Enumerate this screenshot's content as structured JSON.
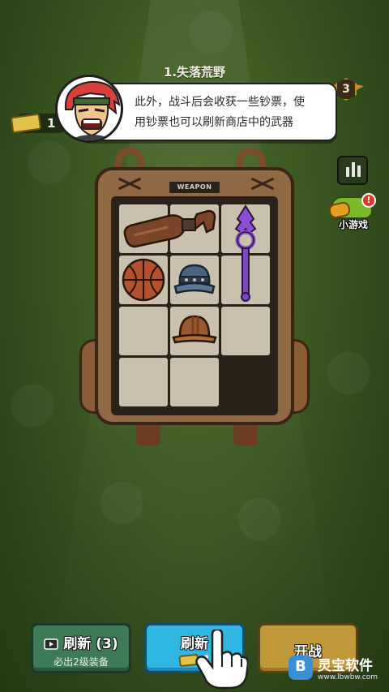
{
  "level": {
    "title": "1.失落荒野"
  },
  "currency": {
    "amount": "1",
    "icon": "banknote-icon"
  },
  "rank": {
    "value": "3"
  },
  "dialog": {
    "text_line1": "此外，战斗后会收获一些钞票，使",
    "text_line2": "用钞票也可以刷新商店中的武器"
  },
  "side": {
    "minigame_label": "小游戏",
    "minigame_badge": "!"
  },
  "backpack": {
    "tag": "WEAPON",
    "items": [
      {
        "name": "bottle-icon",
        "slot": "r1c1-c2"
      },
      {
        "name": "staff-icon",
        "slot": "r1c3-r2c3"
      },
      {
        "name": "basketball-icon",
        "slot": "r2c1"
      },
      {
        "name": "helmet-blue-icon",
        "slot": "r2c2"
      },
      {
        "name": "hard-hat-icon",
        "slot": "r3c2"
      }
    ]
  },
  "buttons": {
    "refresh_label": "刷新 (3)",
    "refresh_sub": "必出2级装备",
    "buy_refresh_label": "刷新",
    "buy_refresh_cost": "1",
    "start_label": "开战"
  },
  "watermark": {
    "name": "灵宝软件",
    "url": "www.lbwbw.com"
  }
}
